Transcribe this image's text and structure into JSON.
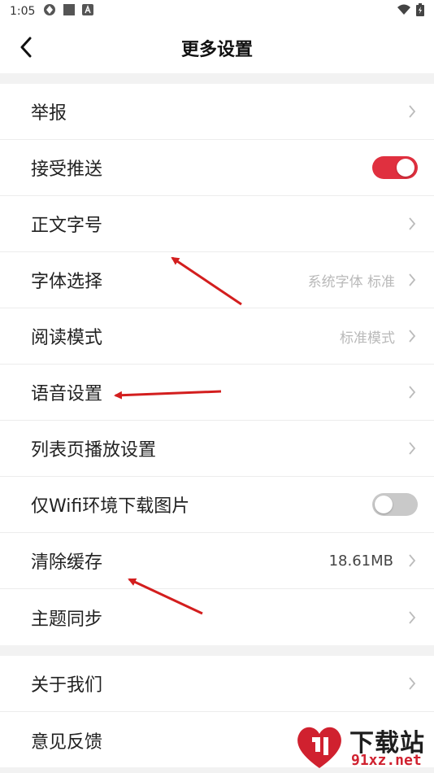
{
  "status": {
    "time": "1:05"
  },
  "header": {
    "title": "更多设置"
  },
  "settings": [
    {
      "label": "举报",
      "value": "",
      "control": "chevron"
    },
    {
      "label": "接受推送",
      "value": "",
      "control": "toggle",
      "state": "on"
    },
    {
      "label": "正文字号",
      "value": "",
      "control": "chevron"
    },
    {
      "label": "字体选择",
      "value": "系统字体 标准",
      "control": "chevron"
    },
    {
      "label": "阅读模式",
      "value": "标准模式",
      "control": "chevron"
    },
    {
      "label": "语音设置",
      "value": "",
      "control": "chevron"
    },
    {
      "label": "列表页播放设置",
      "value": "",
      "control": "chevron"
    },
    {
      "label": "仅Wifi环境下载图片",
      "value": "",
      "control": "toggle",
      "state": "off"
    },
    {
      "label": "清除缓存",
      "value": "18.61MB",
      "control": "chevron"
    },
    {
      "label": "主题同步",
      "value": "",
      "control": "chevron"
    }
  ],
  "about": [
    {
      "label": "关于我们"
    },
    {
      "label": "意见反馈"
    }
  ],
  "colors": {
    "accent": "#e0303f",
    "arrow": "#d31e1e"
  },
  "watermark": {
    "brand": "下载站",
    "url": "91xz.net"
  }
}
